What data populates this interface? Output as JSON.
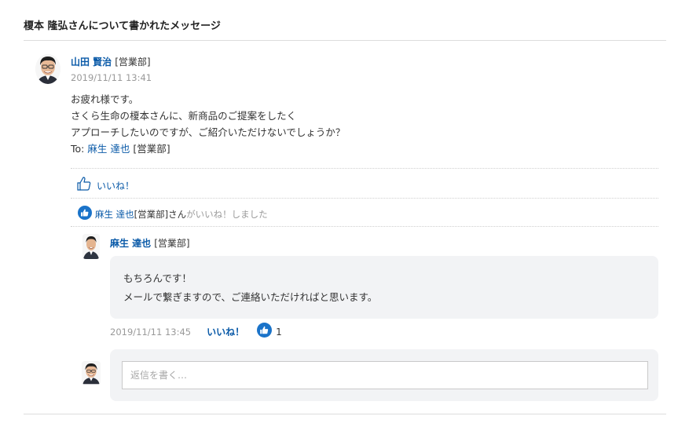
{
  "header": {
    "title": "榎本 隆弘さんについて書かれたメッセージ"
  },
  "post": {
    "author_name": "山田 賢治",
    "author_dept": "[営業部]",
    "time": "2019/11/11 13:41",
    "lines": [
      "お疲れ様です。",
      "さくら生命の榎本さんに、新商品のご提案をしたく",
      "アプローチしたいのですが、ご紹介いただけないでしょうか？"
    ],
    "to_label": "To:",
    "to_name": "麻生 達也",
    "to_dept": "[営業部]",
    "like_label": "いいね！"
  },
  "likes": {
    "name": "麻生 達也",
    "dept": "[営業部]",
    "suffix": "さん",
    "tail": "がいいね！しました"
  },
  "reply": {
    "author_name": "麻生 達也",
    "author_dept": "[営業部]",
    "lines": [
      "もちろんです！",
      "メールで繋ぎますので、ご連絡いただければと思います。"
    ],
    "time": "2019/11/11 13:45",
    "like_label": "いいね！",
    "like_count": "1"
  },
  "compose": {
    "placeholder": "返信を書く…"
  },
  "colors": {
    "link": "#0a5aa8",
    "like_badge": "#1a73c9",
    "bubble": "#f2f3f5"
  },
  "icons": {
    "like_outline": "thumbs-up-outline-icon",
    "like_badge": "thumbs-up-badge-icon"
  }
}
